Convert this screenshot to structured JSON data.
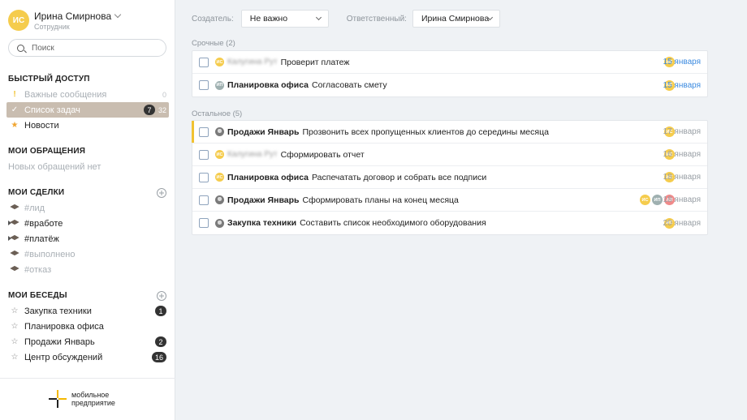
{
  "user": {
    "initials": "ИС",
    "name": "Ирина Смирнова",
    "role": "Сотрудник"
  },
  "search": {
    "placeholder": "Поиск"
  },
  "quick_access": {
    "title": "БЫСТРЫЙ ДОСТУП",
    "items": [
      {
        "label": "Важные сообщения",
        "icon": "exclamation-icon",
        "count": "0"
      },
      {
        "label": "Список задач",
        "icon": "check-icon",
        "badge": "7",
        "count": "32"
      },
      {
        "label": "Новости",
        "icon": "star-icon"
      }
    ]
  },
  "appeals": {
    "title": "МОИ ОБРАЩЕНИЯ",
    "empty": "Новых обращений нет"
  },
  "deals": {
    "title": "МОИ СДЕЛКИ",
    "items": [
      {
        "label": "#лид"
      },
      {
        "label": "#вработе"
      },
      {
        "label": "#платёж"
      },
      {
        "label": "#выполнено"
      },
      {
        "label": "#отказ"
      }
    ]
  },
  "chats": {
    "title": "МОИ БЕСЕДЫ",
    "items": [
      {
        "label": "Закупка техники",
        "badge": "1"
      },
      {
        "label": "Планировка офиса"
      },
      {
        "label": "Продажи Январь",
        "badge": "2"
      },
      {
        "label": "Центр обсуждений",
        "badge": "16"
      }
    ]
  },
  "logo": {
    "line1": "мобильное",
    "line2": "предприятие"
  },
  "filters": {
    "creator_label": "Создатель:",
    "creator_value": "Не важно",
    "assignee_label": "Ответственный:",
    "assignee_value": "Ирина Смирнова"
  },
  "groups": {
    "urgent": {
      "title": "Срочные (2)",
      "tasks": [
        {
          "author": "Калугина Рут",
          "project": "",
          "text": "Проверит платеж",
          "assignees": [
            "ИС"
          ],
          "date": "15 января"
        },
        {
          "author_initials": "ИП",
          "project": "Планировка офиса",
          "text": "Согласовать смету",
          "assignees": [
            "ИС"
          ],
          "date": "15 января"
        }
      ]
    },
    "other": {
      "title": "Остальное (5)",
      "tasks": [
        {
          "project": "Продажи Январь",
          "text": "Прозвонить всех пропущенных клиентов до середины месяца",
          "assignees": [
            "ИС"
          ],
          "date": "17 января"
        },
        {
          "author": "Калугина Рут",
          "text": "Сформировать отчет",
          "assignees": [
            "ИС"
          ],
          "date": "16 января"
        },
        {
          "author_initials": "ИС",
          "project": "Планировка офиса",
          "text": "Распечатать договор и собрать все подписи",
          "assignees": [
            "ИС"
          ],
          "date": "18 января"
        },
        {
          "project": "Продажи Январь",
          "text": "Сформировать планы на конец месяца",
          "assignees": [
            "ИС",
            "ИП",
            "АП"
          ],
          "date": "18 января"
        },
        {
          "project": "Закупка техники",
          "text": "Составить список необходимого оборудования",
          "assignees": [
            "ИС"
          ],
          "date": "20 января"
        }
      ]
    }
  },
  "colors": {
    "accent_yellow": "#f5cc4d",
    "urgent_date": "#3d8be0",
    "active_item": "#c9bdb0",
    "flag": "#f1c232"
  }
}
